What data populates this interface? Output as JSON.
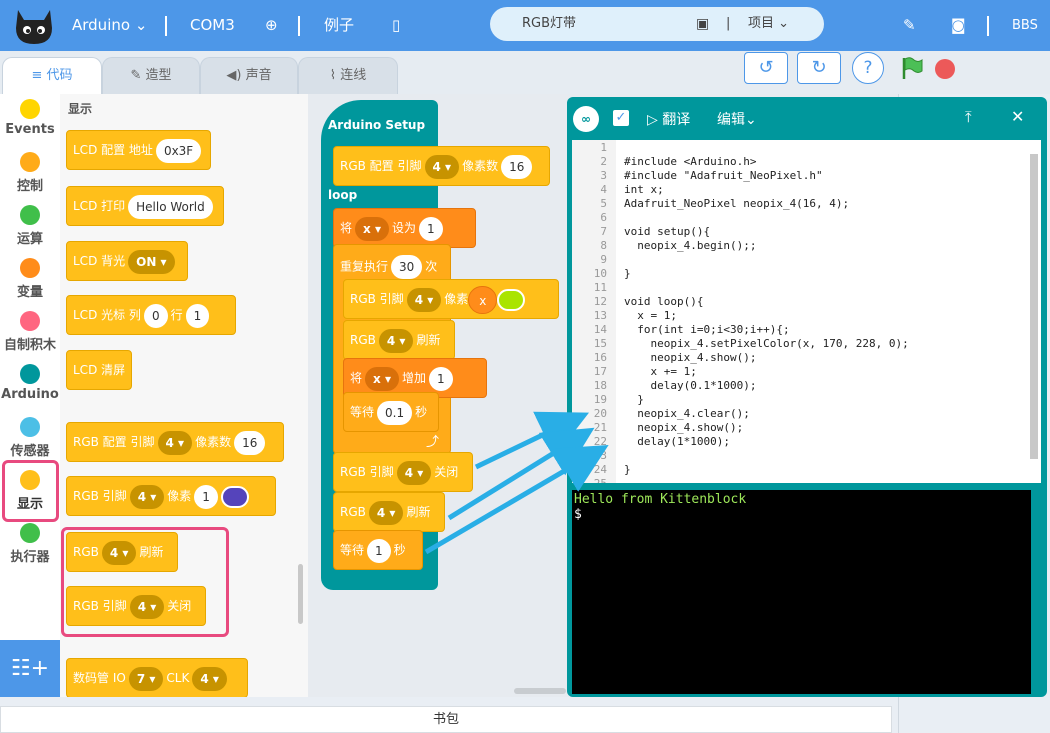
{
  "topbar": {
    "board": "Arduino",
    "port": "COM3",
    "examples": "例子",
    "project_name": "RGB灯带",
    "project_menu": "项目",
    "bbs": "BBS"
  },
  "tabs": {
    "code": "代码",
    "costume": "造型",
    "sound": "声音",
    "wiring": "连线"
  },
  "categories": {
    "events": "Events",
    "control": "控制",
    "operators": "运算",
    "variables": "变量",
    "myblocks": "自制积木",
    "arduino": "Arduino",
    "sensors": "传感器",
    "display": "显示",
    "actuators": "执行器"
  },
  "palette": {
    "section": "显示",
    "lcd_config": "LCD 配置 地址",
    "lcd_addr": "0x3F",
    "lcd_print": "LCD 打印",
    "lcd_print_val": "Hello World",
    "lcd_backlight": "LCD 背光",
    "lcd_backlight_val": "ON",
    "lcd_cursor": "LCD 光标 列",
    "lcd_cursor_col": "0",
    "lcd_row": "行",
    "lcd_cursor_row": "1",
    "lcd_clear": "LCD 清屏",
    "rgb_config": "RGB 配置 引脚",
    "rgb_config_pin": "4",
    "pixel_count": "像素数",
    "pixel_count_val": "16",
    "rgb_pin": "RGB 引脚",
    "rgb_pin_val": "4",
    "pixel": "像素",
    "pixel_val": "1",
    "rgb": "RGB",
    "rgb_refresh_pin": "4",
    "refresh": "刷新",
    "rgb_off_pin": "4",
    "off": "关闭",
    "seg_io": "数码管 IO",
    "seg_io_val": "7",
    "clk": "CLK",
    "clk_val": "4"
  },
  "workspace": {
    "setup": "Arduino Setup",
    "loop": "loop",
    "setup_pin": "4",
    "setup_count": "16",
    "set": "将",
    "set_var": "x",
    "set_to": "设为",
    "set_val": "1",
    "repeat": "重复执行",
    "repeat_val": "30",
    "times": "次",
    "px_pin": "4",
    "px_var": "x",
    "refresh_pin": "4",
    "change": "将",
    "change_var": "x",
    "change_by": "增加",
    "change_val": "1",
    "wait": "等待",
    "wait_val1": "0.1",
    "sec": "秒",
    "off_pin": "4",
    "refresh_pin2": "4",
    "wait_val2": "1"
  },
  "ide": {
    "compile": "翻译",
    "edit": "编辑",
    "upload_icon": "upload-icon",
    "close_icon": "close-icon"
  },
  "code_lines": [
    {
      "n": "1",
      "t": ""
    },
    {
      "n": "2",
      "t": "#include <Arduino.h>"
    },
    {
      "n": "3",
      "t": "#include \"Adafruit_NeoPixel.h\""
    },
    {
      "n": "4",
      "t": "int x;"
    },
    {
      "n": "5",
      "t": "Adafruit_NeoPixel neopix_4(16, 4);"
    },
    {
      "n": "6",
      "t": ""
    },
    {
      "n": "7",
      "t": "void setup(){"
    },
    {
      "n": "8",
      "t": "  neopix_4.begin();;"
    },
    {
      "n": "9",
      "t": ""
    },
    {
      "n": "10",
      "t": "}"
    },
    {
      "n": "11",
      "t": ""
    },
    {
      "n": "12",
      "t": "void loop(){"
    },
    {
      "n": "13",
      "t": "  x = 1;"
    },
    {
      "n": "14",
      "t": "  for(int i=0;i<30;i++){;"
    },
    {
      "n": "15",
      "t": "    neopix_4.setPixelColor(x, 170, 228, 0);"
    },
    {
      "n": "16",
      "t": "    neopix_4.show();"
    },
    {
      "n": "17",
      "t": "    x += 1;"
    },
    {
      "n": "18",
      "t": "    delay(0.1*1000);"
    },
    {
      "n": "19",
      "t": "  }"
    },
    {
      "n": "20",
      "t": "  neopix_4.clear();"
    },
    {
      "n": "21",
      "t": "  neopix_4.show();"
    },
    {
      "n": "22",
      "t": "  delay(1*1000);"
    },
    {
      "n": "23",
      "t": ""
    },
    {
      "n": "24",
      "t": "}"
    },
    {
      "n": "25",
      "t": ""
    }
  ],
  "terminal": {
    "line1": "Hello from Kittenblock",
    "line2": "$"
  },
  "bottom": {
    "backpack": "书包"
  },
  "colors": {
    "accent": "#4d97e8",
    "looks": "#ffbf1a",
    "ide": "#00979c",
    "pixel_color": "#aae400",
    "highlight": "#e84a7f",
    "arrow": "#29aee6"
  }
}
